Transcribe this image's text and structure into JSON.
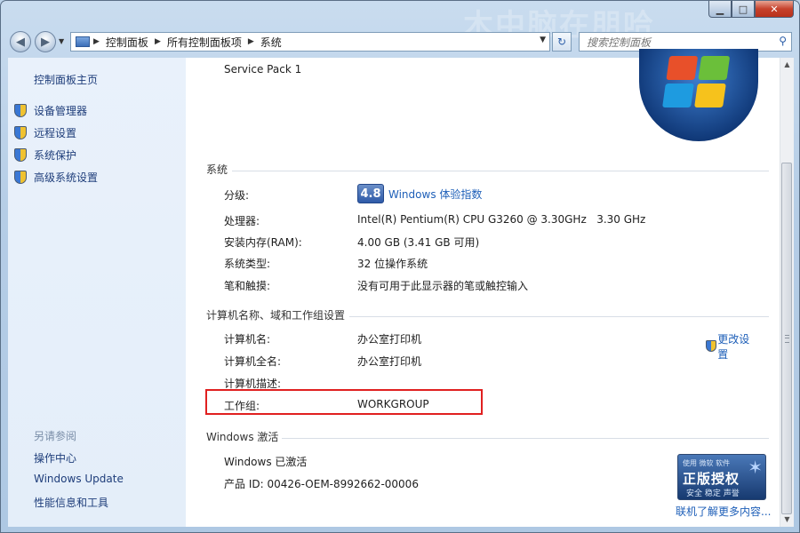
{
  "window": {
    "title_watermark": "木中脑在朋哈",
    "caption": {
      "minimize": "▁",
      "maximize": "□",
      "close": "✕"
    }
  },
  "nav": {
    "back_icon": "back-arrow-icon",
    "forward_icon": "forward-arrow-icon",
    "dropdown_icon": "chevron-down-icon",
    "breadcrumbs": [
      "控制面板",
      "所有控制面板项",
      "系统"
    ],
    "search_placeholder": "搜索控制面板"
  },
  "sidebar": {
    "home": "控制面板主页",
    "items": [
      {
        "label": "设备管理器",
        "icon": "shield-icon"
      },
      {
        "label": "远程设置",
        "icon": "shield-icon"
      },
      {
        "label": "系统保护",
        "icon": "shield-icon"
      },
      {
        "label": "高级系统设置",
        "icon": "shield-icon"
      }
    ],
    "see_also": "另请参阅",
    "links": [
      "操作中心",
      "Windows Update",
      "性能信息和工具"
    ]
  },
  "content": {
    "service_pack": "Service Pack 1",
    "system": {
      "heading": "系统",
      "rows": [
        {
          "label": "分级:",
          "score": "4.8",
          "value": "Windows 体验指数"
        },
        {
          "label": "处理器:",
          "value": "Intel(R) Pentium(R) CPU G3260 @ 3.30GHz   3.30 GHz"
        },
        {
          "label": "安装内存(RAM):",
          "value": "4.00 GB (3.41 GB 可用)"
        },
        {
          "label": "系统类型:",
          "value": "32 位操作系统"
        },
        {
          "label": "笔和触摸:",
          "value": "没有可用于此显示器的笔或触控输入"
        }
      ]
    },
    "computer": {
      "heading": "计算机名称、域和工作组设置",
      "change_settings": "更改设置",
      "rows": [
        {
          "label": "计算机名:",
          "value": "办公室打印机"
        },
        {
          "label": "计算机全名:",
          "value": "办公室打印机"
        },
        {
          "label": "计算机描述:",
          "value": ""
        },
        {
          "label": "工作组:",
          "value": "WORKGROUP"
        }
      ]
    },
    "activation": {
      "heading": "Windows 激活",
      "status": "Windows 已激活",
      "product_id": "产品 ID: 00426-OEM-8992662-00006",
      "genuine_top": "使用 微软 软件",
      "genuine_main": "正版授权",
      "genuine_sub": "安全 稳定 声誉",
      "more_link": "联机了解更多内容..."
    }
  },
  "colors": {
    "link": "#1e5fb8",
    "sidebar_bg": "#e9f1fb",
    "highlight": "#e02020"
  }
}
